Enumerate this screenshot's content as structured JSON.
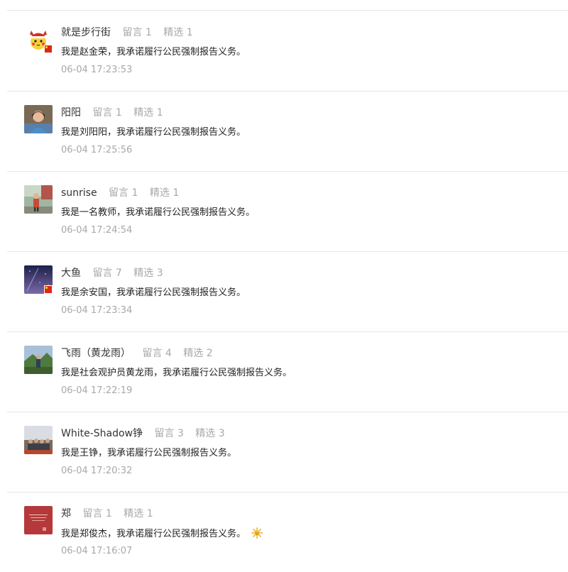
{
  "labels": {
    "reply_prefix": "留言",
    "featured_prefix": "精选"
  },
  "comments": [
    {
      "nickname": "就是步行街",
      "replies": "1",
      "featured": "1",
      "content": "我是赵金荣，我承诺履行公民强制报告义务。",
      "time": "06-04 17:23:53",
      "avatar_icon": "cartoon-mascot-avatar-icon",
      "flag": true
    },
    {
      "nickname": "阳阳",
      "replies": "1",
      "featured": "1",
      "content": "我是刘阳阳，我承诺履行公民强制报告义务。",
      "time": "06-04 17:25:56",
      "avatar_icon": "portrait-photo-avatar-icon",
      "flag": false
    },
    {
      "nickname": "sunrise",
      "replies": "1",
      "featured": "1",
      "content": "我是一名教师，我承诺履行公民强制报告义务。",
      "time": "06-04 17:24:54",
      "avatar_icon": "outdoor-photo-avatar-icon",
      "flag": false
    },
    {
      "nickname": "大鱼",
      "replies": "7",
      "featured": "3",
      "content": "我是余安国，我承诺履行公民强制报告义务。",
      "time": "06-04 17:23:34",
      "avatar_icon": "night-sky-avatar-icon",
      "flag": true
    },
    {
      "nickname": "飞雨（黄龙雨）",
      "replies": "4",
      "featured": "2",
      "content": "我是社会观护员黄龙雨，我承诺履行公民强制报告义务。",
      "time": "06-04 17:22:19",
      "avatar_icon": "landscape-photo-avatar-icon",
      "flag": false
    },
    {
      "nickname": "White-Shadow铮",
      "replies": "3",
      "featured": "3",
      "content": "我是王铮，我承诺履行公民强制报告义务。",
      "time": "06-04 17:20:32",
      "avatar_icon": "group-photo-avatar-icon",
      "flag": false
    },
    {
      "nickname": "郑",
      "replies": "1",
      "featured": "1",
      "content": "我是郑俊杰，我承诺履行公民强制报告义务。",
      "time": "06-04 17:16:07",
      "avatar_icon": "calligraphy-card-avatar-icon",
      "flag": false,
      "trailing_emoji": "sun-emoji-icon"
    }
  ],
  "colors": {
    "divider": "#e6e6e6",
    "muted_text": "#a8a8a8",
    "name_text": "#333333",
    "flag_red": "#de2910",
    "flag_yellow": "#ffde00"
  }
}
